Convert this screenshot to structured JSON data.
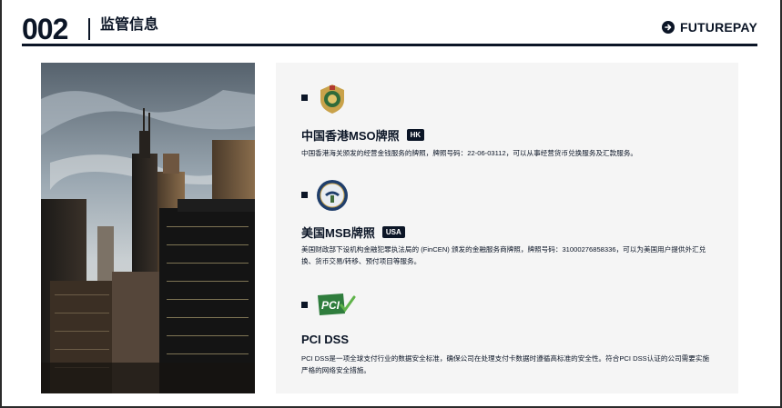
{
  "header": {
    "page_number": "002",
    "title": "监管信息",
    "brand": "FUTUREPAY"
  },
  "photo": {
    "subject": "city-skyline"
  },
  "licenses": [
    {
      "logo": "hk-customs-emblem-icon",
      "name": "中国香港MSO牌照",
      "badge": "HK",
      "description": "中国香港海关颁发的经营金钱服务的牌照，牌照号码：22-06-03112，可以从事经营货币兑换服务及汇款服务。"
    },
    {
      "logo": "fincen-seal-icon",
      "name": "美国MSB牌照",
      "badge": "USA",
      "description": "美国财政部下设机构金融犯罪执法局的 (FinCEN) 颁发的金融服务商牌照，牌照号码：31000276858336，可以为美国用户提供外汇兑换、货币交易/转移、预付项目等服务。"
    },
    {
      "logo": "pci-logo-icon",
      "logo_text": "PCI",
      "name": "PCI DSS",
      "badge": "",
      "description": "PCI DSS是一项全球支付行业的数据安全标准，确保公司在处理支付卡数据时遵循高标准的安全性。符合PCI DSS认证的公司需要实施严格的网络安全措施。"
    }
  ],
  "colors": {
    "navy": "#0b1526",
    "panel": "#f5f5f5",
    "pci_green": "#2f7d3d"
  }
}
